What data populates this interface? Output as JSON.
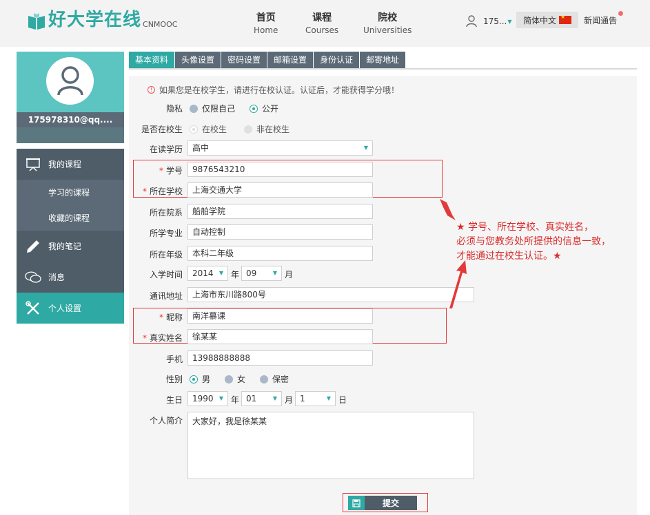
{
  "header": {
    "logo_text": "好大学在线",
    "logo_sub": "CNMOOC",
    "nav": [
      {
        "cn": "首页",
        "en": "Home"
      },
      {
        "cn": "课程",
        "en": "Courses"
      },
      {
        "cn": "院校",
        "en": "Universities"
      }
    ],
    "user_name": "175...",
    "language": "简体中文",
    "news": "新闻通告",
    "colors": {
      "brand": "#2fa9a3",
      "sidebar": "#4f5d68",
      "alert": "#e23a3a"
    }
  },
  "profile": {
    "email": "175978310@qq...."
  },
  "menu": {
    "my_courses": "我的课程",
    "learning_courses": "学习的课程",
    "favorite_courses": "收藏的课程",
    "my_notes": "我的笔记",
    "messages": "消息",
    "personal_settings": "个人设置"
  },
  "tabs": [
    "基本资料",
    "头像设置",
    "密码设置",
    "邮箱设置",
    "身份认证",
    "邮寄地址"
  ],
  "form": {
    "notice": "如果您是在校学生，请进行在校认证。认证后，才能获得学分哦！",
    "privacy_label": "隐私",
    "privacy_opt1": "仅限自己",
    "privacy_opt2": "公开",
    "student_label": "是否在校生",
    "student_opt1": "在校生",
    "student_opt2": "非在校生",
    "education_label": "在读学历",
    "education_value": "高中",
    "student_id_label": "学号",
    "student_id_value": "9876543210",
    "school_label": "所在学校",
    "school_value": "上海交通大学",
    "department_label": "所在院系",
    "department_value": "船舶学院",
    "major_label": "所学专业",
    "major_value": "自动控制",
    "grade_label": "所在年级",
    "grade_value": "本科二年级",
    "enroll_label": "入学时间",
    "enroll_year": "2014",
    "enroll_year_unit": "年",
    "enroll_month": "09",
    "enroll_month_unit": "月",
    "address_label": "通讯地址",
    "address_value": "上海市东川路800号",
    "nickname_label": "昵称",
    "nickname_value": "南洋慕课",
    "realname_label": "真实姓名",
    "realname_value": "徐某某",
    "phone_label": "手机",
    "phone_value": "13988888888",
    "gender_label": "性别",
    "gender_male": "男",
    "gender_female": "女",
    "gender_secret": "保密",
    "birthday_label": "生日",
    "birth_year": "1990",
    "birth_year_unit": "年",
    "birth_month": "01",
    "birth_month_unit": "月",
    "birth_day": "1",
    "birth_day_unit": "日",
    "bio_label": "个人简介",
    "bio_value": "大家好，我是徐某某",
    "required_mark": "*",
    "submit": "提交"
  },
  "annotation": {
    "line1": "★ 学号、所在学校、真实姓名，",
    "line2": "必须与您教务处所提供的信息一致，",
    "line3": "才能通过在校生认证。★"
  }
}
